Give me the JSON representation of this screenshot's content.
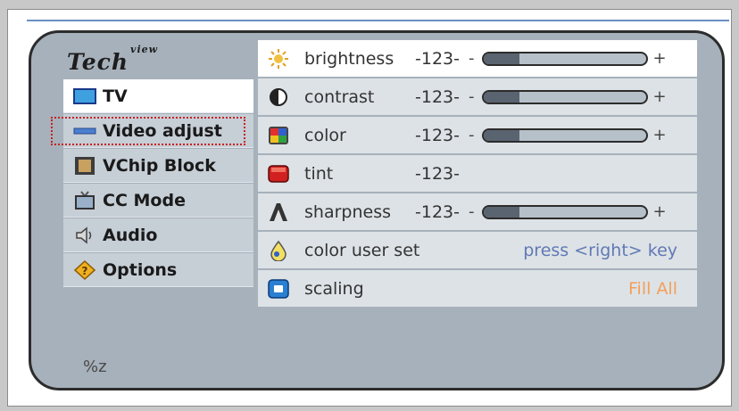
{
  "logo": {
    "main": "Tech",
    "sup": "view"
  },
  "menu": {
    "items": [
      {
        "label": "TV",
        "icon": "tv-icon"
      },
      {
        "label": "Video adjust",
        "icon": "video-icon"
      },
      {
        "label": "VChip Block",
        "icon": "vchip-icon"
      },
      {
        "label": "CC Mode",
        "icon": "cc-icon"
      },
      {
        "label": "Audio",
        "icon": "speaker-icon"
      },
      {
        "label": "Options",
        "icon": "options-icon"
      }
    ],
    "selected_index": 0,
    "highlighted_index": 1
  },
  "settings": {
    "brightness": {
      "label": "brightness",
      "value": "-123-",
      "minus": "-",
      "plus": "+",
      "level": 0.22
    },
    "contrast": {
      "label": "contrast",
      "value": "-123-",
      "minus": "-",
      "plus": "+",
      "level": 0.22
    },
    "color": {
      "label": "color",
      "value": "-123-",
      "minus": "-",
      "plus": "+",
      "level": 0.22
    },
    "tint": {
      "label": "tint",
      "value": "-123-"
    },
    "sharpness": {
      "label": "sharpness",
      "value": "-123-",
      "minus": "-",
      "plus": "+",
      "level": 0.22
    },
    "color_user_set": {
      "label": "color user set",
      "hint": "press <right> key"
    },
    "scaling": {
      "label": "scaling",
      "value": "Fill All"
    }
  },
  "status": {
    "text": "%z"
  },
  "colors": {
    "screen": "#a6b1bb",
    "row": "#dde2e6",
    "hint_blue": "#6079b5",
    "value_orange": "#f2a05a",
    "highlight": "#c82020"
  }
}
